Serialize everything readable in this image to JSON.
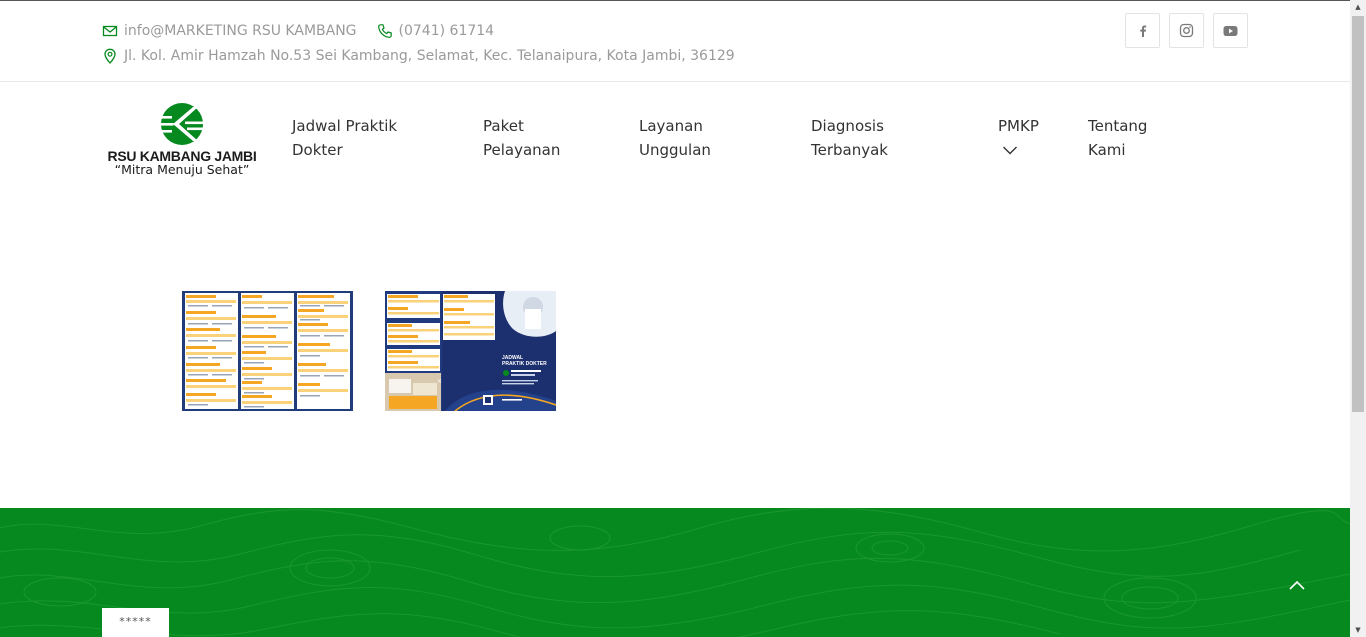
{
  "topbar": {
    "email": "info@MARKETING RSU KAMBANG",
    "phone": "(0741) 61714",
    "address": "Jl. Kol. Amir Hamzah No.53 Sei Kambang, Selamat, Kec. Telanaipura, Kota Jambi, 36129",
    "social": [
      "facebook-icon",
      "instagram-icon",
      "youtube-icon"
    ]
  },
  "logo": {
    "name": "RSU KAMBANG JAMBI",
    "tagline": "“Mitra Menuju Sehat”",
    "brand_color": "#06891e"
  },
  "nav": [
    {
      "line1": "Jadwal Praktik",
      "line2": "Dokter"
    },
    {
      "line1": "Paket",
      "line2": "Pelayanan"
    },
    {
      "line1": "Layanan",
      "line2": "Unggulan"
    },
    {
      "line1": "Diagnosis",
      "line2": "Terbanyak"
    },
    {
      "line1": "PMKP",
      "line2": ""
    },
    {
      "line1": "Tentang",
      "line2": "Kami"
    }
  ],
  "content": {
    "thumbnail_1_title": "",
    "thumbnail_2_title": "JADWAL PRAKTIK DOKTER"
  },
  "footer": {
    "background": "#06891e",
    "password_mask": "*****"
  }
}
